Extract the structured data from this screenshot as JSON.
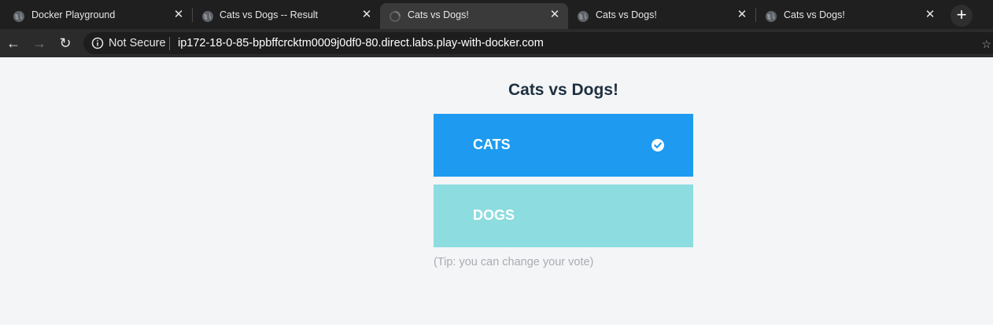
{
  "browser": {
    "tabs": [
      {
        "title": "Docker Playground",
        "active": false
      },
      {
        "title": "Cats vs Dogs -- Result",
        "active": false
      },
      {
        "title": "Cats vs Dogs!",
        "active": true
      },
      {
        "title": "Cats vs Dogs!",
        "active": false
      },
      {
        "title": "Cats vs Dogs!",
        "active": false
      }
    ],
    "close_glyph": "✕",
    "new_tab_glyph": "+",
    "security_label": "Not Secure",
    "url": "ip172-18-0-85-bpbffcrcktm0009j0df0-80.direct.labs.play-with-docker.com",
    "back_glyph": "←",
    "forward_glyph": "→",
    "reload_glyph": "↻",
    "star_glyph": "☆"
  },
  "page": {
    "title": "Cats vs Dogs!",
    "options": [
      {
        "label": "CATS",
        "selected": true,
        "color": "#1e9bf0"
      },
      {
        "label": "DOGS",
        "selected": false,
        "color": "#8ddcdf"
      }
    ],
    "tip": "(Tip: you can change your vote)"
  },
  "colors": {
    "tab_strip": "#1f1f1f",
    "active_tab": "#3a3a3a",
    "toolbar": "#2b2b2b",
    "page_bg": "#f4f5f7",
    "heading": "#1e3040",
    "tip": "#a8acb2"
  }
}
